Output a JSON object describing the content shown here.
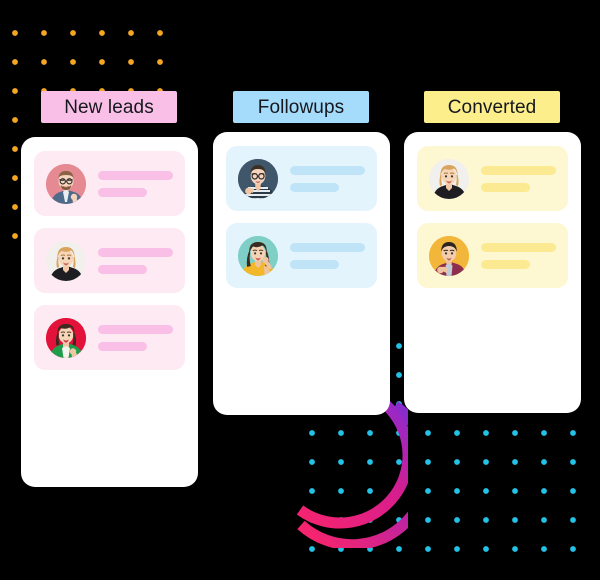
{
  "board": {
    "columns": [
      {
        "id": "new-leads",
        "title": "New leads",
        "header_bg": "#F9BFE7",
        "card_bg": "#FDEAF3",
        "line_color": "#F9BFE7",
        "cards": [
          {
            "id": "lead-1",
            "avatar_name": "avatar-man-glasses-denim",
            "avatar_bg": "#E58A93"
          },
          {
            "id": "lead-2",
            "avatar_name": "avatar-woman-blonde-black-top",
            "avatar_bg": "#F2F0EC"
          },
          {
            "id": "lead-3",
            "avatar_name": "avatar-woman-green-jacket",
            "avatar_bg": "#E3123B"
          }
        ]
      },
      {
        "id": "followups",
        "title": "Followups",
        "header_bg": "#A6DCFB",
        "card_bg": "#E4F4FD",
        "line_color": "#BFE4F8",
        "cards": [
          {
            "id": "followup-1",
            "avatar_name": "avatar-man-striped-shirt",
            "avatar_bg": "#40576B"
          },
          {
            "id": "followup-2",
            "avatar_name": "avatar-woman-yellow-sweater",
            "avatar_bg": "#7FCFC6"
          }
        ]
      },
      {
        "id": "converted",
        "title": "Converted",
        "header_bg": "#FBEE8B",
        "card_bg": "#FDF7D2",
        "line_color": "#FBEA92",
        "cards": [
          {
            "id": "converted-1",
            "avatar_name": "avatar-woman-blonde-black-top",
            "avatar_bg": "#F2F0EC"
          },
          {
            "id": "converted-2",
            "avatar_name": "avatar-man-maroon-jacket",
            "avatar_bg": "#F2B73A"
          }
        ]
      }
    ]
  },
  "decor": {
    "dot_grid_top_left_color": "#F5A623",
    "dot_grid_bottom_right_color": "#22C3E6",
    "arc_gradient_start": "#7B2FD6",
    "arc_gradient_end": "#F6246E",
    "background_color": "#000000"
  }
}
